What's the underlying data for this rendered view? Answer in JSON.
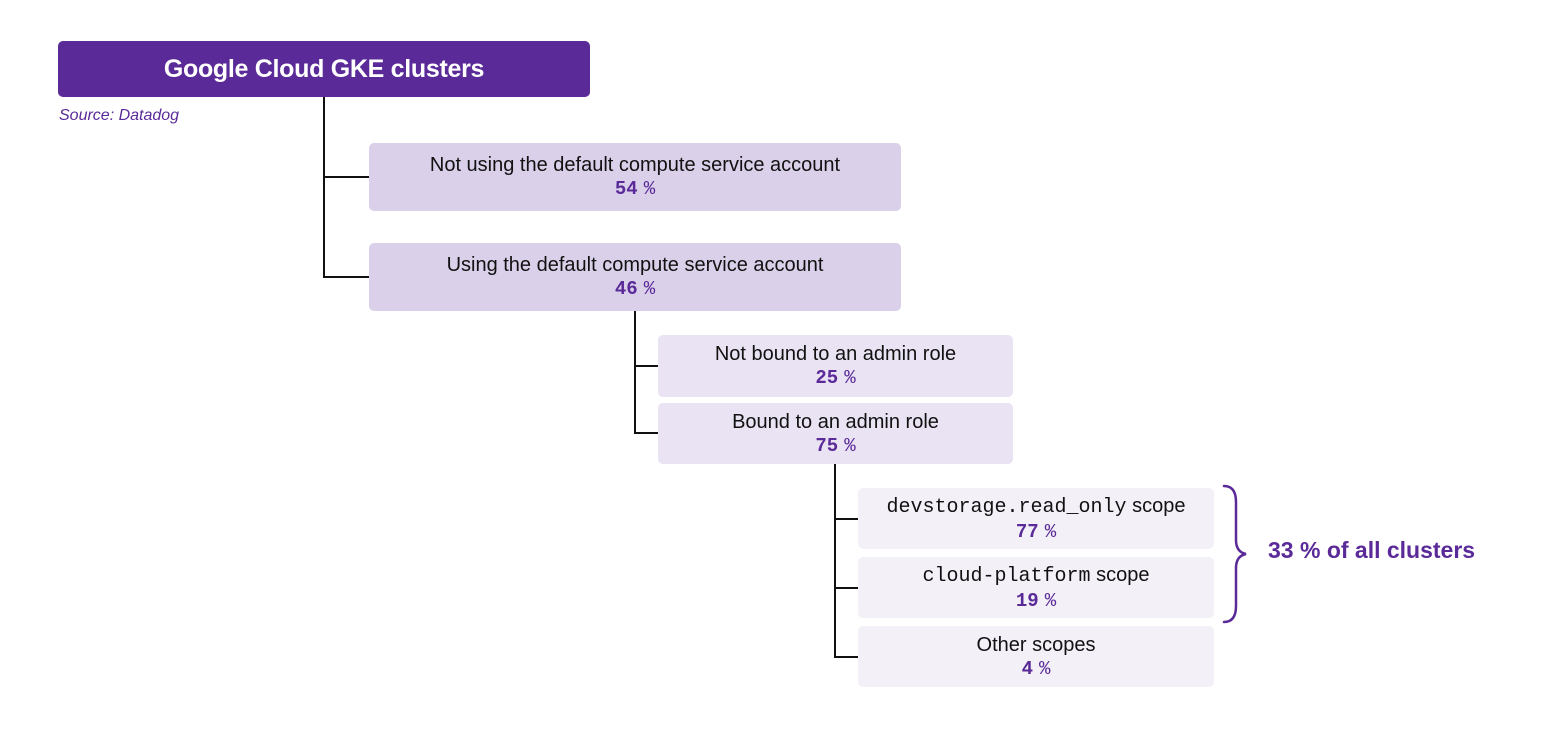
{
  "root": {
    "title": "Google Cloud GKE clusters",
    "source": "Source: Datadog"
  },
  "level1": [
    {
      "label": "Not using the default compute service account",
      "value": "54",
      "unit": "%"
    },
    {
      "label": "Using the default compute service account",
      "value": "46",
      "unit": "%"
    }
  ],
  "level2": [
    {
      "label": "Not bound to an admin role",
      "value": "25",
      "unit": "%"
    },
    {
      "label": "Bound to an admin role",
      "value": "75",
      "unit": "%"
    }
  ],
  "level3": [
    {
      "code": "devstorage.read_only",
      "label": "scope",
      "value": "77",
      "unit": "%"
    },
    {
      "code": "cloud-platform",
      "label": "scope",
      "value": "19",
      "unit": "%"
    },
    {
      "label": "Other scopes",
      "value": "4",
      "unit": "%"
    }
  ],
  "annotation": {
    "text": "33 % of all clusters"
  },
  "colors": {
    "accent": "#5a2a98",
    "level1_bg": "#dbd0ea",
    "level2_bg": "#e9e3f3",
    "level3_bg": "#f3f0f8"
  }
}
